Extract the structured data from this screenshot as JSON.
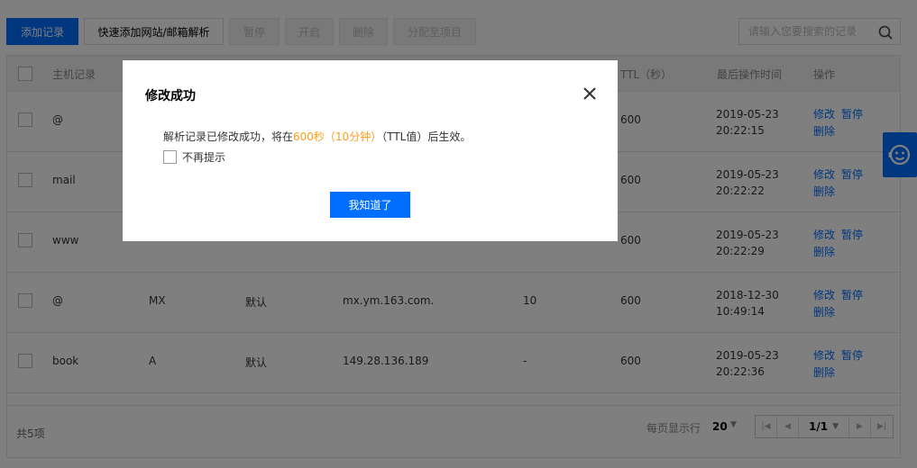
{
  "toolbar": {
    "add_label": "添加记录",
    "quick_add_label": "快速添加网站/邮箱解析",
    "pause_label": "暂停",
    "enable_label": "开启",
    "delete_label": "删除",
    "assign_label": "分配至项目"
  },
  "search": {
    "placeholder": "请输入您要搜索的记录"
  },
  "table": {
    "headers": [
      "主机记录",
      "TTL（秒）",
      "最后操作时间",
      "操作"
    ],
    "rows": [
      {
        "host": "@",
        "type": "",
        "line": "",
        "value": "",
        "mx": "",
        "ttl": "600",
        "date": "2019-05-23",
        "time": "20:22:15"
      },
      {
        "host": "mail",
        "type": "",
        "line": "",
        "value": "",
        "mx": "",
        "ttl": "600",
        "date": "2019-05-23",
        "time": "20:22:22"
      },
      {
        "host": "www",
        "type": "",
        "line": "",
        "value": "",
        "mx": "",
        "ttl": "600",
        "date": "2019-05-23",
        "time": "20:22:29"
      },
      {
        "host": "@",
        "type": "MX",
        "line": "默认",
        "value": "mx.ym.163.com.",
        "mx": "10",
        "ttl": "600",
        "date": "2018-12-30",
        "time": "10:49:14"
      },
      {
        "host": "book",
        "type": "A",
        "line": "默认",
        "value": "149.28.136.189",
        "mx": "-",
        "ttl": "600",
        "date": "2019-05-23",
        "time": "20:22:36"
      }
    ],
    "ops": {
      "edit": "修改",
      "pause": "暂停",
      "delete": "删除"
    }
  },
  "footer": {
    "total": "共5项",
    "per_page_label": "每页显示行",
    "per_page_value": "20",
    "page": "1/1"
  },
  "modal": {
    "title": "修改成功",
    "msg_before": "解析记录已修改成功，将在",
    "msg_highlight": "600秒（10分钟）",
    "msg_after": "（TTL值）后生效。",
    "checkbox_label": "不再提示",
    "confirm_label": "我知道了"
  },
  "colors": {
    "accent": "#006eff",
    "highlight": "#ff9c19"
  },
  "icons": [
    "search-icon",
    "close-icon",
    "customer-service-icon"
  ]
}
